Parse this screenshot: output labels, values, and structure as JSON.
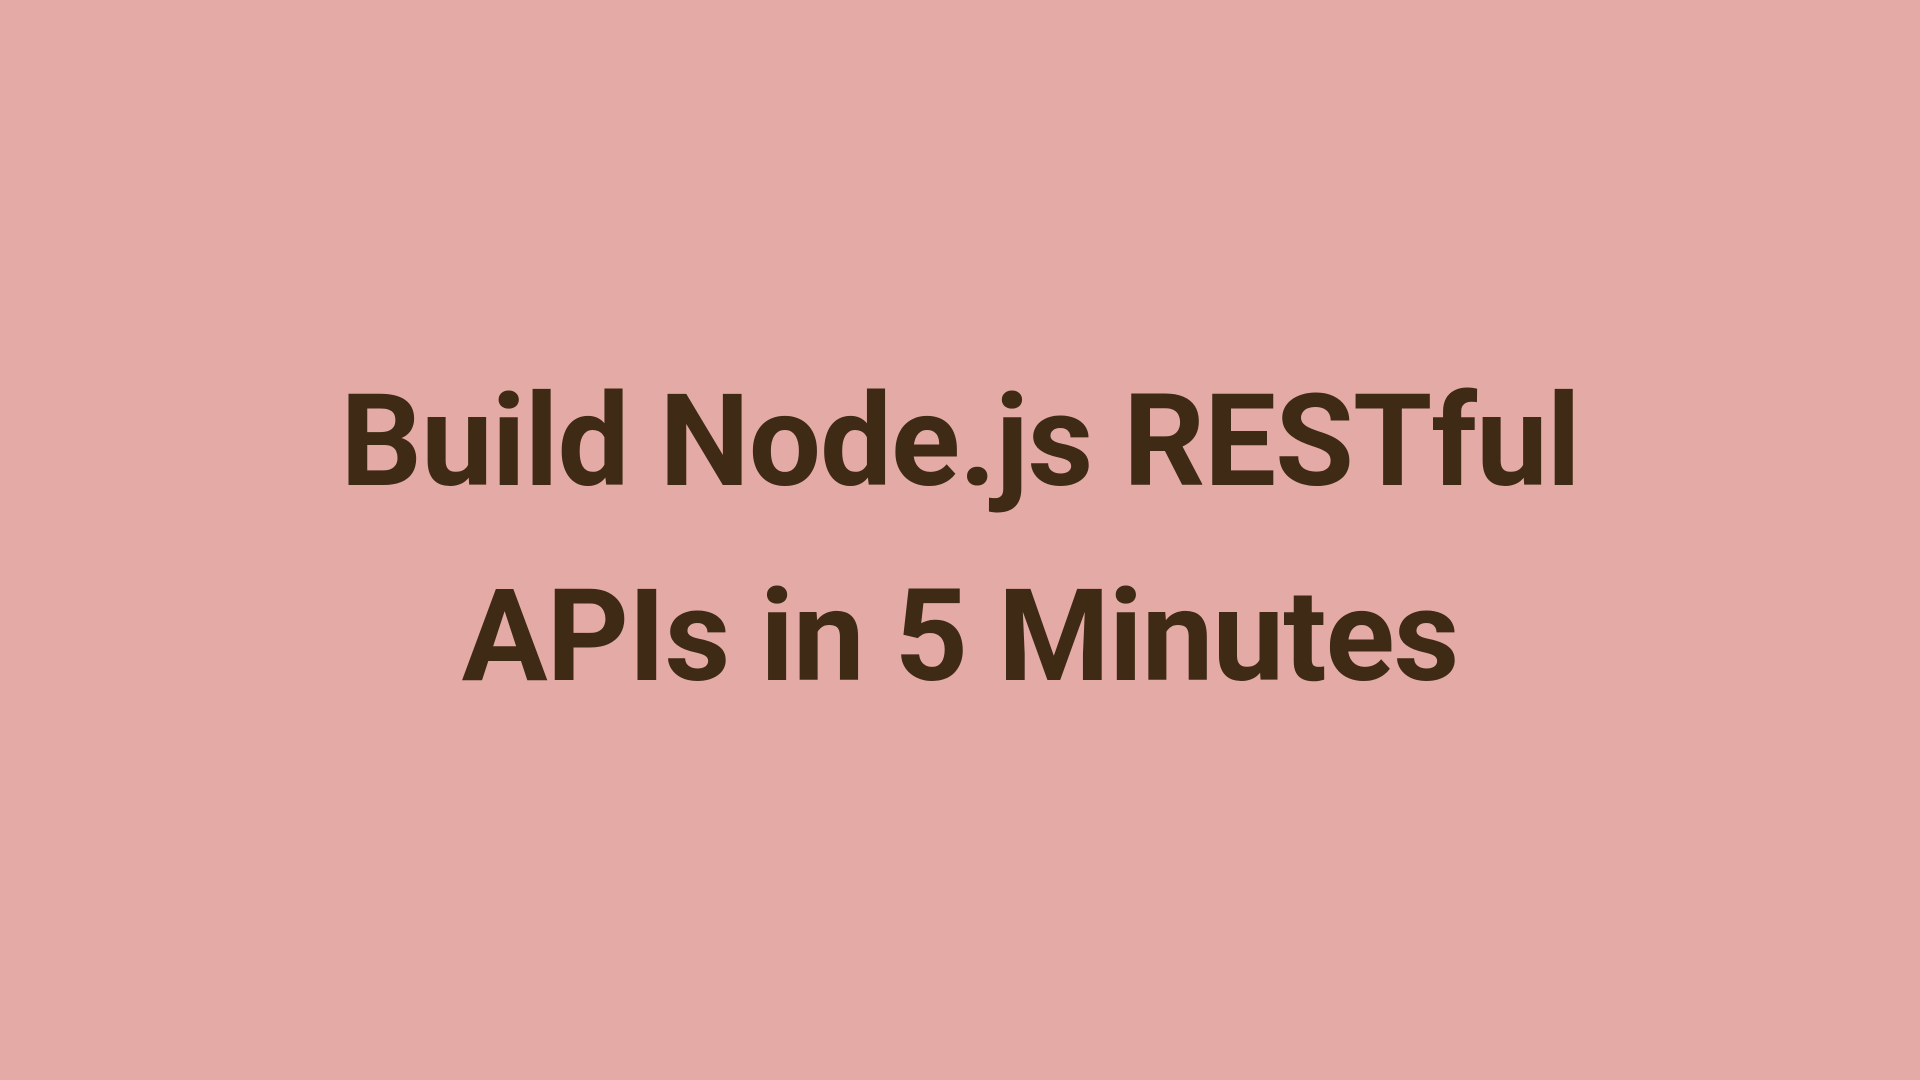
{
  "card": {
    "title": "Build Node.js RESTful APIs in 5 Minutes",
    "background_color": "#e4aaa6",
    "text_color": "#3e2a15"
  }
}
